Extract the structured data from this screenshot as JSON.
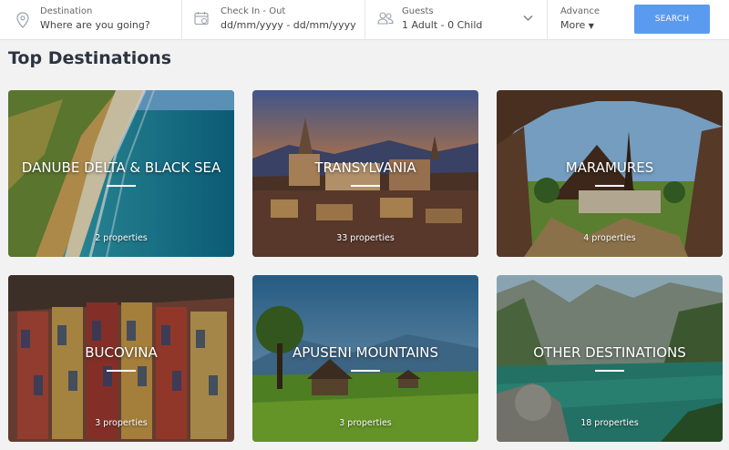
{
  "search": {
    "destination": {
      "label": "Destination",
      "placeholder": "Where are you going?",
      "icon": "map-pin-icon"
    },
    "dates": {
      "label": "Check In - Out",
      "value": "dd/mm/yyyy - dd/mm/yyyy",
      "icon": "calendar-icon"
    },
    "guests": {
      "label": "Guests",
      "value": "1 Adult - 0 Child",
      "icon": "users-icon"
    },
    "advance": {
      "label": "Advance",
      "value": "More"
    },
    "button_label": "SEARCH",
    "accent_color": "#5b9bef"
  },
  "section": {
    "title": "Top Destinations"
  },
  "destinations": [
    {
      "name": "DANUBE DELTA & BLACK SEA",
      "properties": "2 properties"
    },
    {
      "name": "TRANSYLVANIA",
      "properties": "33 properties"
    },
    {
      "name": "MARAMURES",
      "properties": "4 properties"
    },
    {
      "name": "BUCOVINA",
      "properties": "3 properties"
    },
    {
      "name": "APUSENI MOUNTAINS",
      "properties": "3 properties"
    },
    {
      "name": "OTHER DESTINATIONS",
      "properties": "18 properties"
    }
  ]
}
